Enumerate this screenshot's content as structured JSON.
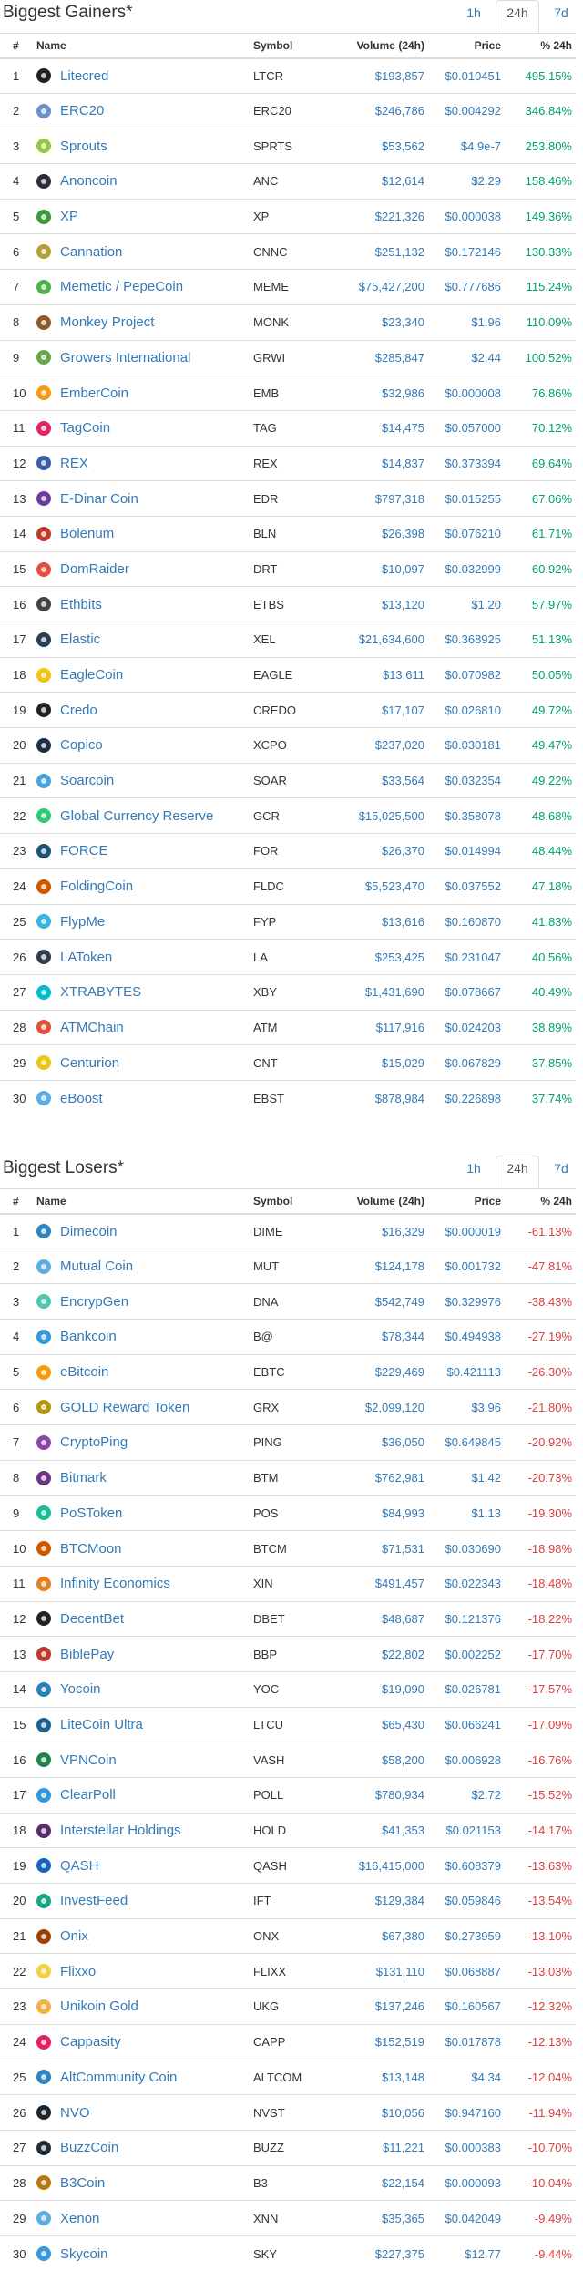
{
  "gainers": {
    "title": "Biggest Gainers*",
    "tabs": [
      "1h",
      "24h",
      "7d"
    ],
    "active_tab": "24h",
    "columns": [
      "#",
      "Name",
      "Symbol",
      "Volume (24h)",
      "Price",
      "% 24h"
    ],
    "rows": [
      {
        "rank": "1",
        "name": "Litecred",
        "symbol": "LTCR",
        "volume": "$193,857",
        "price": "$0.010451",
        "change": "495.15%",
        "icon_color": "#222222"
      },
      {
        "rank": "2",
        "name": "ERC20",
        "symbol": "ERC20",
        "volume": "$246,786",
        "price": "$0.004292",
        "change": "346.84%",
        "icon_color": "#6b8fc9"
      },
      {
        "rank": "3",
        "name": "Sprouts",
        "symbol": "SPRTS",
        "volume": "$53,562",
        "price": "$4.9e-7",
        "change": "253.80%",
        "icon_color": "#9bc53d"
      },
      {
        "rank": "4",
        "name": "Anoncoin",
        "symbol": "ANC",
        "volume": "$12,614",
        "price": "$2.29",
        "change": "158.46%",
        "icon_color": "#2d2d3a"
      },
      {
        "rank": "5",
        "name": "XP",
        "symbol": "XP",
        "volume": "$221,326",
        "price": "$0.000038",
        "change": "149.36%",
        "icon_color": "#3a9a3a"
      },
      {
        "rank": "6",
        "name": "Cannation",
        "symbol": "CNNC",
        "volume": "$251,132",
        "price": "$0.172146",
        "change": "130.33%",
        "icon_color": "#b5a032"
      },
      {
        "rank": "7",
        "name": "Memetic / PepeCoin",
        "symbol": "MEME",
        "volume": "$75,427,200",
        "price": "$0.777686",
        "change": "115.24%",
        "icon_color": "#4caf50"
      },
      {
        "rank": "8",
        "name": "Monkey Project",
        "symbol": "MONK",
        "volume": "$23,340",
        "price": "$1.96",
        "change": "110.09%",
        "icon_color": "#8a5a2b"
      },
      {
        "rank": "9",
        "name": "Growers International",
        "symbol": "GRWI",
        "volume": "$285,847",
        "price": "$2.44",
        "change": "100.52%",
        "icon_color": "#6aa84f"
      },
      {
        "rank": "10",
        "name": "EmberCoin",
        "symbol": "EMB",
        "volume": "$32,986",
        "price": "$0.000008",
        "change": "76.86%",
        "icon_color": "#f39c12"
      },
      {
        "rank": "11",
        "name": "TagCoin",
        "symbol": "TAG",
        "volume": "$14,475",
        "price": "$0.057000",
        "change": "70.12%",
        "icon_color": "#e0245e"
      },
      {
        "rank": "12",
        "name": "REX",
        "symbol": "REX",
        "volume": "$14,837",
        "price": "$0.373394",
        "change": "69.64%",
        "icon_color": "#3b5ea8"
      },
      {
        "rank": "13",
        "name": "E-Dinar Coin",
        "symbol": "EDR",
        "volume": "$797,318",
        "price": "$0.015255",
        "change": "67.06%",
        "icon_color": "#6a3d9a"
      },
      {
        "rank": "14",
        "name": "Bolenum",
        "symbol": "BLN",
        "volume": "$26,398",
        "price": "$0.076210",
        "change": "61.71%",
        "icon_color": "#c0392b"
      },
      {
        "rank": "15",
        "name": "DomRaider",
        "symbol": "DRT",
        "volume": "$10,097",
        "price": "$0.032999",
        "change": "60.92%",
        "icon_color": "#e74c3c"
      },
      {
        "rank": "16",
        "name": "Ethbits",
        "symbol": "ETBS",
        "volume": "$13,120",
        "price": "$1.20",
        "change": "57.97%",
        "icon_color": "#444444"
      },
      {
        "rank": "17",
        "name": "Elastic",
        "symbol": "XEL",
        "volume": "$21,634,600",
        "price": "$0.368925",
        "change": "51.13%",
        "icon_color": "#2c3e50"
      },
      {
        "rank": "18",
        "name": "EagleCoin",
        "symbol": "EAGLE",
        "volume": "$13,611",
        "price": "$0.070982",
        "change": "50.05%",
        "icon_color": "#f1c40f"
      },
      {
        "rank": "19",
        "name": "Credo",
        "symbol": "CREDO",
        "volume": "$17,107",
        "price": "$0.026810",
        "change": "49.72%",
        "icon_color": "#222222"
      },
      {
        "rank": "20",
        "name": "Copico",
        "symbol": "XCPO",
        "volume": "$237,020",
        "price": "$0.030181",
        "change": "49.47%",
        "icon_color": "#1f2f3f"
      },
      {
        "rank": "21",
        "name": "Soarcoin",
        "symbol": "SOAR",
        "volume": "$33,564",
        "price": "$0.032354",
        "change": "49.22%",
        "icon_color": "#4aa3df"
      },
      {
        "rank": "22",
        "name": "Global Currency Reserve",
        "symbol": "GCR",
        "volume": "$15,025,500",
        "price": "$0.358078",
        "change": "48.68%",
        "icon_color": "#2ecc71"
      },
      {
        "rank": "23",
        "name": "FORCE",
        "symbol": "FOR",
        "volume": "$26,370",
        "price": "$0.014994",
        "change": "48.44%",
        "icon_color": "#1a5276"
      },
      {
        "rank": "24",
        "name": "FoldingCoin",
        "symbol": "FLDC",
        "volume": "$5,523,470",
        "price": "$0.037552",
        "change": "47.18%",
        "icon_color": "#d35400"
      },
      {
        "rank": "25",
        "name": "FlypMe",
        "symbol": "FYP",
        "volume": "$13,616",
        "price": "$0.160870",
        "change": "41.83%",
        "icon_color": "#3bb3e0"
      },
      {
        "rank": "26",
        "name": "LAToken",
        "symbol": "LA",
        "volume": "$253,425",
        "price": "$0.231047",
        "change": "40.56%",
        "icon_color": "#2d3e50"
      },
      {
        "rank": "27",
        "name": "XTRABYTES",
        "symbol": "XBY",
        "volume": "$1,431,690",
        "price": "$0.078667",
        "change": "40.49%",
        "icon_color": "#00bcd4"
      },
      {
        "rank": "28",
        "name": "ATMChain",
        "symbol": "ATM",
        "volume": "$117,916",
        "price": "$0.024203",
        "change": "38.89%",
        "icon_color": "#e74c3c"
      },
      {
        "rank": "29",
        "name": "Centurion",
        "symbol": "CNT",
        "volume": "$15,029",
        "price": "$0.067829",
        "change": "37.85%",
        "icon_color": "#f1c40f"
      },
      {
        "rank": "30",
        "name": "eBoost",
        "symbol": "EBST",
        "volume": "$878,984",
        "price": "$0.226898",
        "change": "37.74%",
        "icon_color": "#5dade2"
      }
    ]
  },
  "losers": {
    "title": "Biggest Losers*",
    "tabs": [
      "1h",
      "24h",
      "7d"
    ],
    "active_tab": "24h",
    "columns": [
      "#",
      "Name",
      "Symbol",
      "Volume (24h)",
      "Price",
      "% 24h"
    ],
    "rows": [
      {
        "rank": "1",
        "name": "Dimecoin",
        "symbol": "DIME",
        "volume": "$16,329",
        "price": "$0.000019",
        "change": "-61.13%",
        "icon_color": "#2e86c1"
      },
      {
        "rank": "2",
        "name": "Mutual Coin",
        "symbol": "MUT",
        "volume": "$124,178",
        "price": "$0.001732",
        "change": "-47.81%",
        "icon_color": "#5dade2"
      },
      {
        "rank": "3",
        "name": "EncrypGen",
        "symbol": "DNA",
        "volume": "$542,749",
        "price": "$0.329976",
        "change": "-38.43%",
        "icon_color": "#48c9b0"
      },
      {
        "rank": "4",
        "name": "Bankcoin",
        "symbol": "B@",
        "volume": "$78,344",
        "price": "$0.494938",
        "change": "-27.19%",
        "icon_color": "#3498db"
      },
      {
        "rank": "5",
        "name": "eBitcoin",
        "symbol": "EBTC",
        "volume": "$229,469",
        "price": "$0.421113",
        "change": "-26.30%",
        "icon_color": "#f39c12"
      },
      {
        "rank": "6",
        "name": "GOLD Reward Token",
        "symbol": "GRX",
        "volume": "$2,099,120",
        "price": "$3.96",
        "change": "-21.80%",
        "icon_color": "#b7950b"
      },
      {
        "rank": "7",
        "name": "CryptoPing",
        "symbol": "PING",
        "volume": "$36,050",
        "price": "$0.649845",
        "change": "-20.92%",
        "icon_color": "#8e44ad"
      },
      {
        "rank": "8",
        "name": "Bitmark",
        "symbol": "BTM",
        "volume": "$762,981",
        "price": "$1.42",
        "change": "-20.73%",
        "icon_color": "#6c3483"
      },
      {
        "rank": "9",
        "name": "PoSToken",
        "symbol": "POS",
        "volume": "$84,993",
        "price": "$1.13",
        "change": "-19.30%",
        "icon_color": "#1abc9c"
      },
      {
        "rank": "10",
        "name": "BTCMoon",
        "symbol": "BTCM",
        "volume": "$71,531",
        "price": "$0.030690",
        "change": "-18.98%",
        "icon_color": "#d35400"
      },
      {
        "rank": "11",
        "name": "Infinity Economics",
        "symbol": "XIN",
        "volume": "$491,457",
        "price": "$0.022343",
        "change": "-18.48%",
        "icon_color": "#e67e22"
      },
      {
        "rank": "12",
        "name": "DecentBet",
        "symbol": "DBET",
        "volume": "$48,687",
        "price": "$0.121376",
        "change": "-18.22%",
        "icon_color": "#222222"
      },
      {
        "rank": "13",
        "name": "BiblePay",
        "symbol": "BBP",
        "volume": "$22,802",
        "price": "$0.002252",
        "change": "-17.70%",
        "icon_color": "#c0392b"
      },
      {
        "rank": "14",
        "name": "Yocoin",
        "symbol": "YOC",
        "volume": "$19,090",
        "price": "$0.026781",
        "change": "-17.57%",
        "icon_color": "#2980b9"
      },
      {
        "rank": "15",
        "name": "LiteCoin Ultra",
        "symbol": "LTCU",
        "volume": "$65,430",
        "price": "$0.066241",
        "change": "-17.09%",
        "icon_color": "#1f618d"
      },
      {
        "rank": "16",
        "name": "VPNCoin",
        "symbol": "VASH",
        "volume": "$58,200",
        "price": "$0.006928",
        "change": "-16.76%",
        "icon_color": "#1e8449"
      },
      {
        "rank": "17",
        "name": "ClearPoll",
        "symbol": "POLL",
        "volume": "$780,934",
        "price": "$2.72",
        "change": "-15.52%",
        "icon_color": "#3498db"
      },
      {
        "rank": "18",
        "name": "Interstellar Holdings",
        "symbol": "HOLD",
        "volume": "$41,353",
        "price": "$0.021153",
        "change": "-14.17%",
        "icon_color": "#5b2c6f"
      },
      {
        "rank": "19",
        "name": "QASH",
        "symbol": "QASH",
        "volume": "$16,415,000",
        "price": "$0.608379",
        "change": "-13.63%",
        "icon_color": "#1565c0"
      },
      {
        "rank": "20",
        "name": "InvestFeed",
        "symbol": "IFT",
        "volume": "$129,384",
        "price": "$0.059846",
        "change": "-13.54%",
        "icon_color": "#17a589"
      },
      {
        "rank": "21",
        "name": "Onix",
        "symbol": "ONX",
        "volume": "$67,380",
        "price": "$0.273959",
        "change": "-13.10%",
        "icon_color": "#a04000"
      },
      {
        "rank": "22",
        "name": "Flixxo",
        "symbol": "FLIXX",
        "volume": "$131,110",
        "price": "$0.068887",
        "change": "-13.03%",
        "icon_color": "#f4d03f"
      },
      {
        "rank": "23",
        "name": "Unikoin Gold",
        "symbol": "UKG",
        "volume": "$137,246",
        "price": "$0.160567",
        "change": "-12.32%",
        "icon_color": "#f5b041"
      },
      {
        "rank": "24",
        "name": "Cappasity",
        "symbol": "CAPP",
        "volume": "$152,519",
        "price": "$0.017878",
        "change": "-12.13%",
        "icon_color": "#e91e63"
      },
      {
        "rank": "25",
        "name": "AltCommunity Coin",
        "symbol": "ALTCOM",
        "volume": "$13,148",
        "price": "$4.34",
        "change": "-12.04%",
        "icon_color": "#2e86c1"
      },
      {
        "rank": "26",
        "name": "NVO",
        "symbol": "NVST",
        "volume": "$10,056",
        "price": "$0.947160",
        "change": "-11.94%",
        "icon_color": "#1b2631"
      },
      {
        "rank": "27",
        "name": "BuzzCoin",
        "symbol": "BUZZ",
        "volume": "$11,221",
        "price": "$0.000383",
        "change": "-10.70%",
        "icon_color": "#212f3c"
      },
      {
        "rank": "28",
        "name": "B3Coin",
        "symbol": "B3",
        "volume": "$22,154",
        "price": "$0.000093",
        "change": "-10.04%",
        "icon_color": "#b9770e"
      },
      {
        "rank": "29",
        "name": "Xenon",
        "symbol": "XNN",
        "volume": "$35,365",
        "price": "$0.042049",
        "change": "-9.49%",
        "icon_color": "#5dade2"
      },
      {
        "rank": "30",
        "name": "Skycoin",
        "symbol": "SKY",
        "volume": "$227,375",
        "price": "$12.77",
        "change": "-9.44%",
        "icon_color": "#3498db"
      }
    ]
  }
}
